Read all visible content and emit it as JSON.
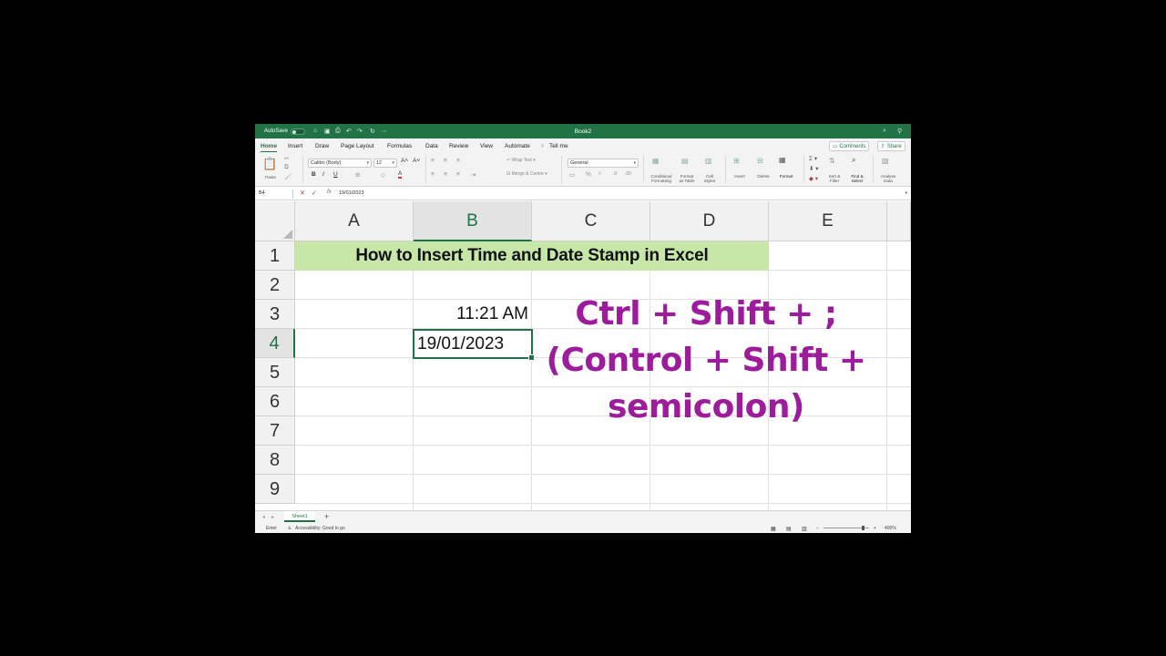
{
  "app": {
    "autosave_label": "AutoSave",
    "doc_title": "Book2",
    "accent": "#217346"
  },
  "menu": {
    "tabs": [
      "Home",
      "Insert",
      "Draw",
      "Page Layout",
      "Formulas",
      "Data",
      "Review",
      "View",
      "Automate",
      "Tell me"
    ],
    "active_tab": "Home",
    "comments_label": "Comments",
    "share_label": "Share"
  },
  "ribbon": {
    "paste_label": "Paste",
    "font_name": "Calibri (Body)",
    "font_size": "12",
    "wrap_text_label": "Wrap Text",
    "merge_label": "Merge & Centre",
    "number_format": "General",
    "conditional_formatting": [
      "Conditional",
      "Formatting"
    ],
    "format_as_table": [
      "Format",
      "as Table"
    ],
    "cell_styles": [
      "Cell",
      "Styles"
    ],
    "insert_label": "Insert",
    "delete_label": "Delete",
    "format_label": "Format",
    "sort_filter": [
      "Sort &",
      "Filter"
    ],
    "find_select": [
      "Find &",
      "Select"
    ],
    "analyse_data": [
      "Analyse",
      "Data"
    ]
  },
  "formula_bar": {
    "name_box": "B4",
    "value": "19/01/2023"
  },
  "grid": {
    "columns": [
      "A",
      "B",
      "C",
      "D",
      "E"
    ],
    "selected_column": "B",
    "rows": [
      "1",
      "2",
      "3",
      "4",
      "5",
      "6",
      "7",
      "8",
      "9"
    ],
    "selected_row": "4",
    "title_cell": "How to Insert Time and Date Stamp in Excel",
    "title_fill": "#c6e7a8",
    "time_cell": "11:21 AM",
    "date_cell": "19/01/2023"
  },
  "overlay": {
    "line1": "Ctrl + Shift + ;",
    "line2": "(Control + Shift +",
    "line3": "semicolon)",
    "color": "#9c1c9c"
  },
  "sheets": {
    "tabs": [
      "Sheet1"
    ],
    "add_label": "+"
  },
  "status": {
    "mode": "Enter",
    "accessibility": "Accessibility: Good to go",
    "zoom": "400%"
  }
}
